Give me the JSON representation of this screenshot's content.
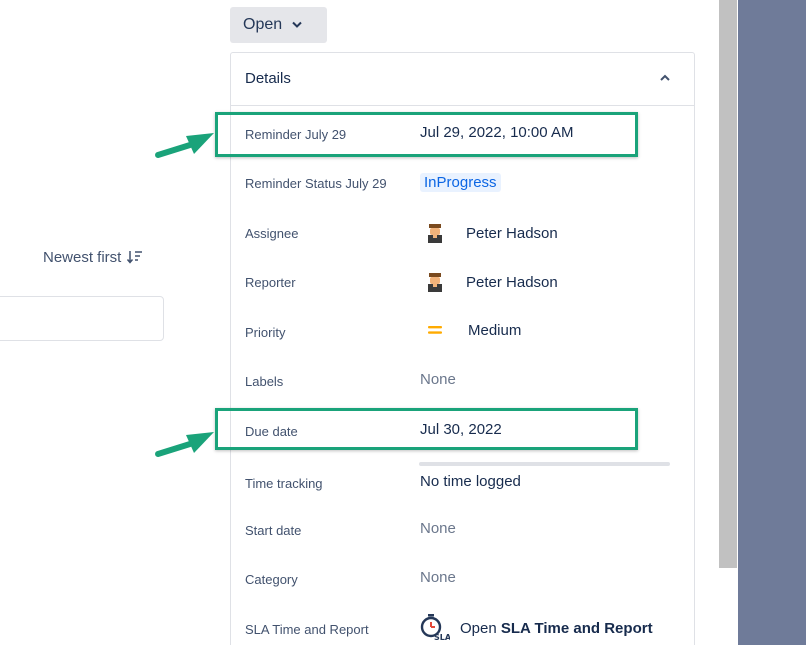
{
  "activity": {
    "sort_label": "Newest first"
  },
  "status": {
    "label": "Open"
  },
  "details": {
    "title": "Details",
    "rows": [
      {
        "label": "Reminder July 29",
        "value": "Jul 29, 2022, 10:00 AM"
      },
      {
        "label": "Reminder Status July 29",
        "value": "InProgress"
      },
      {
        "label": "Assignee",
        "value": "Peter Hadson"
      },
      {
        "label": "Reporter",
        "value": "Peter Hadson"
      },
      {
        "label": "Priority",
        "value": "Medium"
      },
      {
        "label": "Labels",
        "value": "None"
      },
      {
        "label": "Due date",
        "value": "Jul 30, 2022"
      },
      {
        "label": "Time tracking",
        "value": "No time logged"
      },
      {
        "label": "Start date",
        "value": "None"
      },
      {
        "label": "Category",
        "value": "None"
      },
      {
        "label": "SLA Time and Report",
        "value_prefix": "Open",
        "value_strong": "SLA Time and Report"
      }
    ]
  },
  "sla_icon_text": "SLA",
  "colors": {
    "highlight": "#1aa37a",
    "priority_medium": "#ffab00",
    "lozenge_text": "#0c66e4",
    "side_panel": "#6f7b99"
  }
}
